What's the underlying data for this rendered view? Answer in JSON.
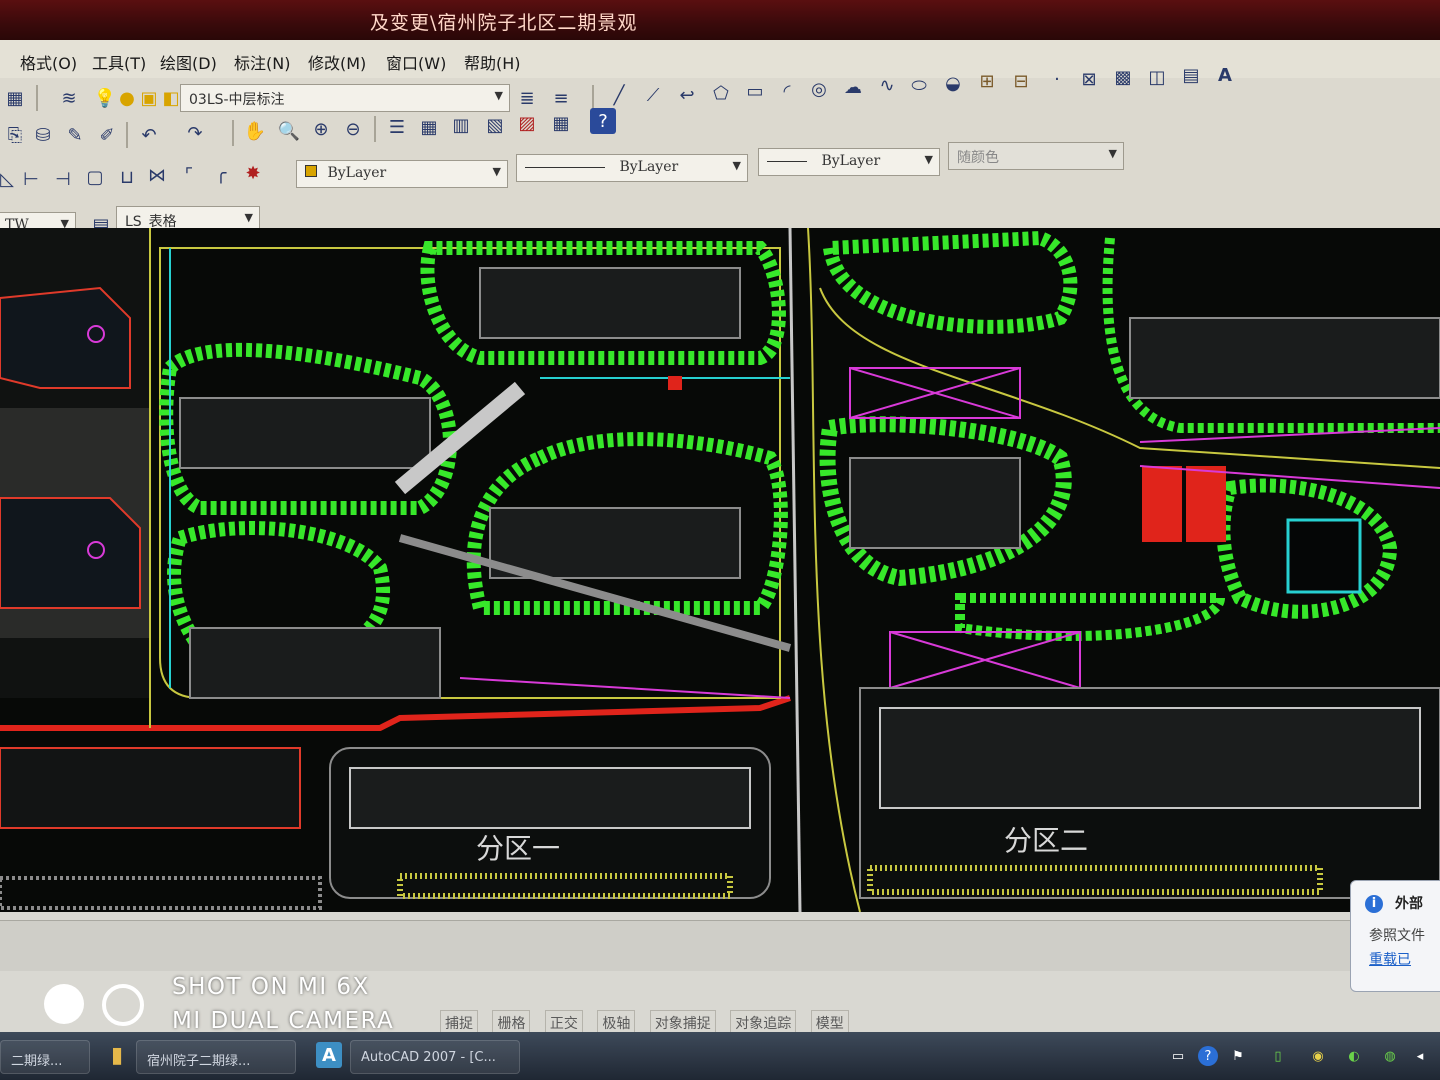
{
  "window": {
    "title": "及变更\\宿州院子北区二期景观"
  },
  "menu": {
    "items": [
      "格式(O)",
      "工具(T)",
      "绘图(D)",
      "标注(N)",
      "修改(M)",
      "窗口(W)",
      "帮助(H)"
    ]
  },
  "layers": {
    "current_layer": "03LS-中层标注"
  },
  "properties": {
    "color": "ByLayer",
    "linetype": "ByLayer",
    "lineweight": "ByLayer",
    "plot_style": "随颜色"
  },
  "styles": {
    "left_combo": "TW",
    "table_style": "LS_表格"
  },
  "drawing": {
    "labels": {
      "zone_left": "分区一",
      "zone_right": "分区二"
    },
    "colors": {
      "background": "#070907",
      "tree": "#37e82a",
      "road": "#c8c840",
      "cyan": "#27d1d1",
      "magenta": "#d83ad8",
      "red": "#e0241b"
    }
  },
  "notification": {
    "title": "外部",
    "message": "参照文件",
    "link": "重载已"
  },
  "taskbar": {
    "items": [
      "二期绿...",
      "宿州院子二期绿...",
      "AutoCAD 2007 - [C..."
    ]
  },
  "watermark": {
    "line1": "SHOT ON MI 6X",
    "line2": "MI DUAL CAMERA"
  },
  "status": {
    "items": [
      "捕捉",
      "栅格",
      "正交",
      "极轴",
      "对象捕捉",
      "对象追踪",
      "模型"
    ]
  }
}
